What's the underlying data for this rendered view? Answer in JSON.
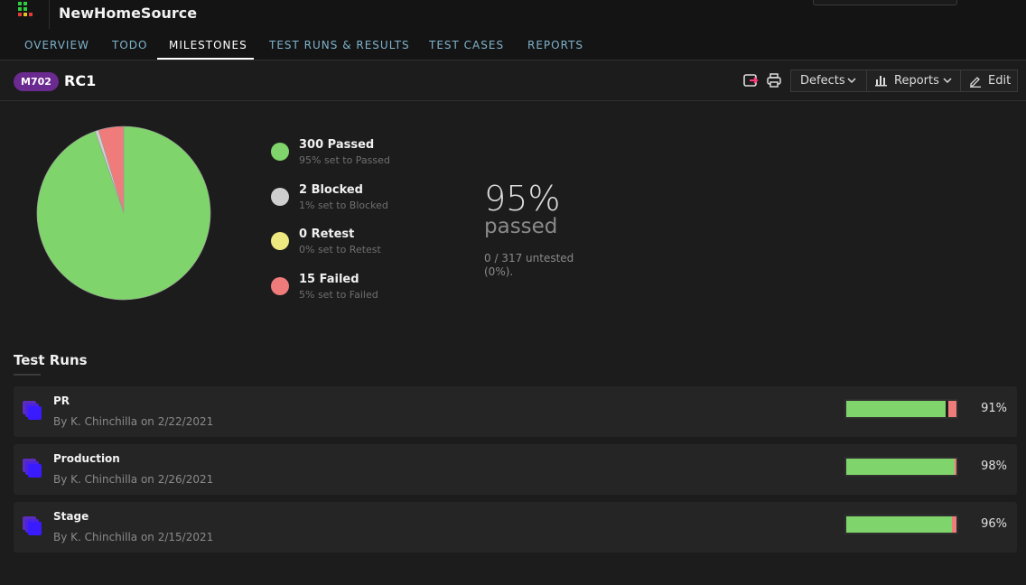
{
  "header": {
    "project_title": "NewHomeSource"
  },
  "tabs": [
    {
      "label": "OVERVIEW",
      "active": false
    },
    {
      "label": "TODO",
      "active": false
    },
    {
      "label": "MILESTONES",
      "active": true
    },
    {
      "label": "TEST RUNS & RESULTS",
      "active": false
    },
    {
      "label": "TEST CASES",
      "active": false
    },
    {
      "label": "REPORTS",
      "active": false
    }
  ],
  "milestone": {
    "badge": "M702",
    "name": "RC1",
    "buttons": {
      "defects": "Defects",
      "reports": "Reports",
      "edit": "Edit"
    }
  },
  "chart_data": {
    "type": "pie",
    "categories": [
      "Passed",
      "Blocked",
      "Retest",
      "Failed"
    ],
    "values": [
      300,
      2,
      0,
      15
    ],
    "colors": [
      "#7fd46b",
      "#cfcfcf",
      "#eee880",
      "#ef7b7b"
    ]
  },
  "legend": [
    {
      "title": "300 Passed",
      "sub": "95% set to Passed",
      "color": "#7fd46b"
    },
    {
      "title": "2 Blocked",
      "sub": "1% set to Blocked",
      "color": "#cfcfcf"
    },
    {
      "title": "0 Retest",
      "sub": "0% set to Retest",
      "color": "#eee880"
    },
    {
      "title": "15 Failed",
      "sub": "5% set to Failed",
      "color": "#ef7b7b"
    }
  ],
  "summary": {
    "percent": "95%",
    "label": "passed",
    "untested": "0 / 317 untested (0%)."
  },
  "test_runs": {
    "title": "Test Runs",
    "rows": [
      {
        "name": "PR",
        "meta": "By K. Chinchilla on 2/22/2021",
        "percent": "91%",
        "passed_fraction": 0.9,
        "failed_fraction": 0.07
      },
      {
        "name": "Production",
        "meta": "By K. Chinchilla on 2/26/2021",
        "percent": "98%",
        "passed_fraction": 0.98,
        "failed_fraction": 0.02
      },
      {
        "name": "Stage",
        "meta": "By K. Chinchilla on 2/15/2021",
        "percent": "96%",
        "passed_fraction": 0.96,
        "failed_fraction": 0.04
      }
    ]
  }
}
